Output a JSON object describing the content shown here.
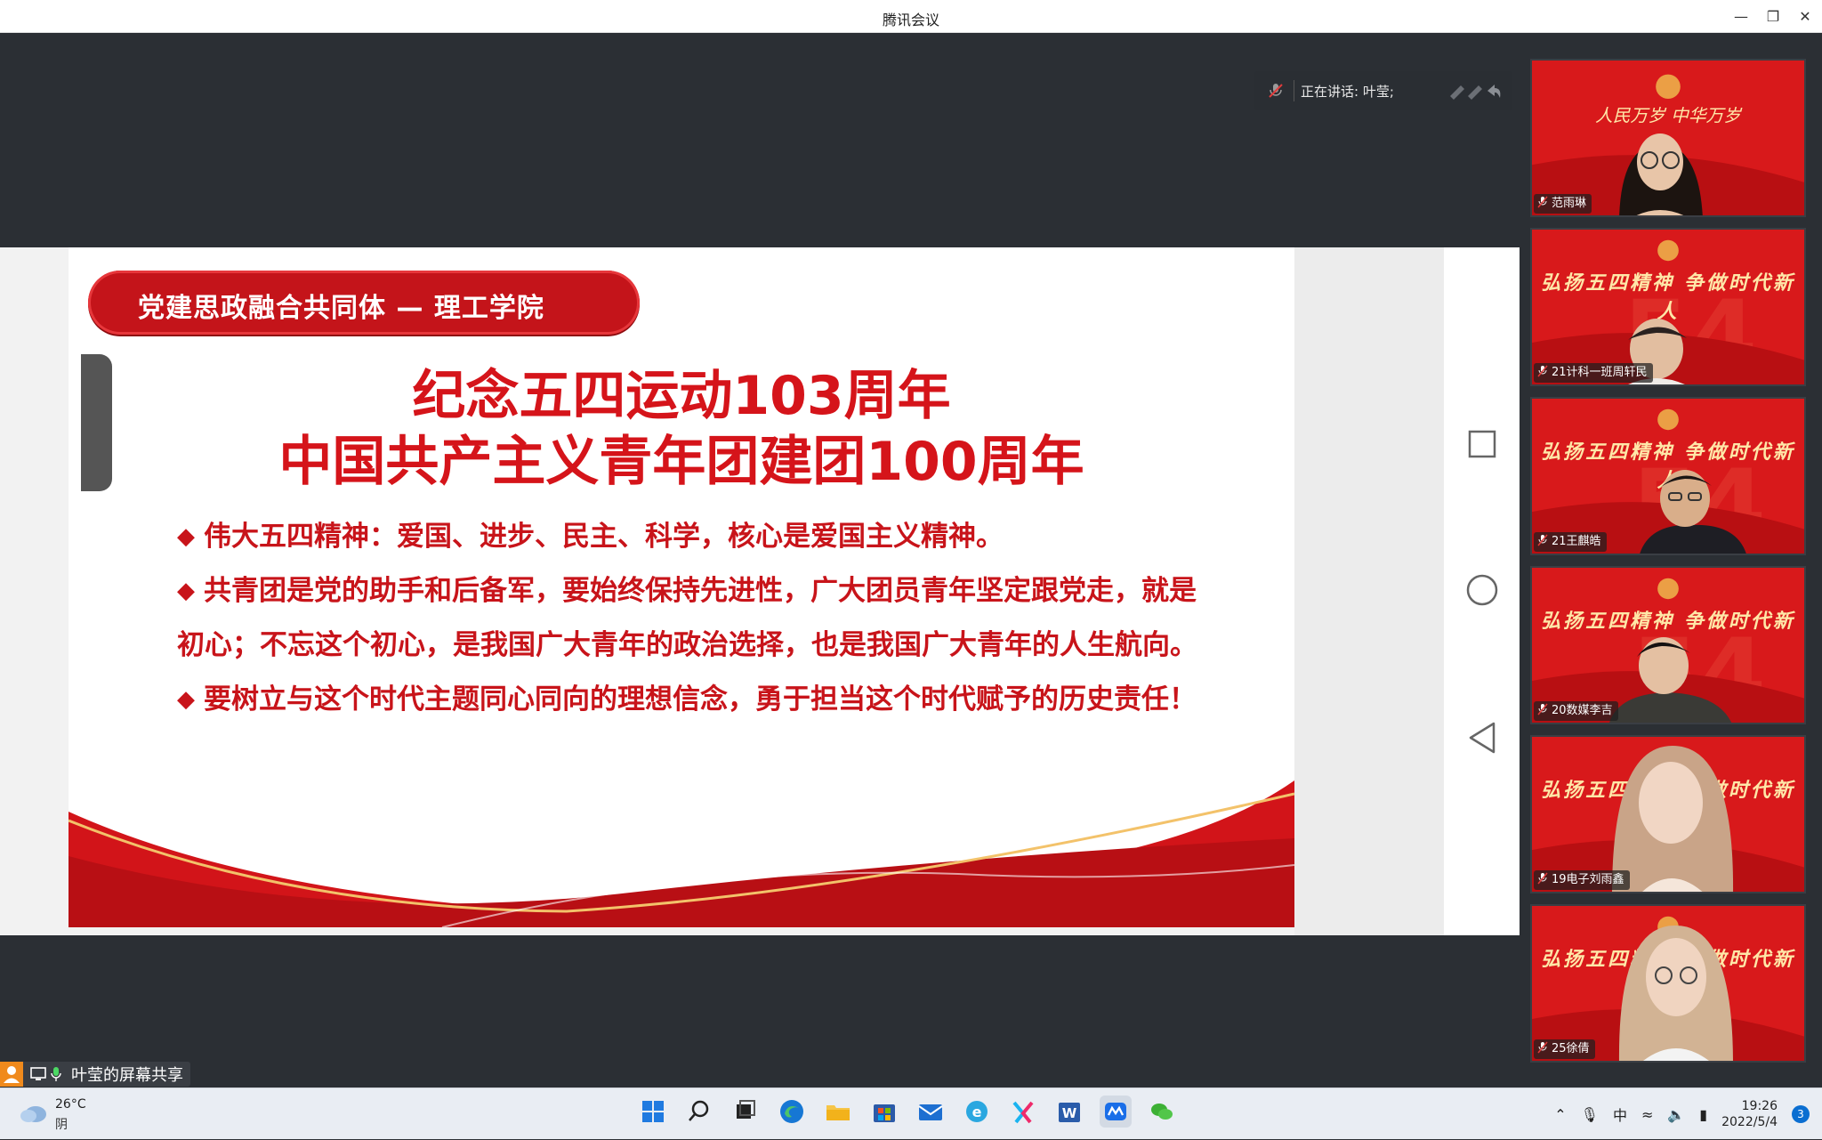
{
  "window": {
    "title": "腾讯会议",
    "minimize_icon": "minimize-icon",
    "restore_icon": "restore-icon",
    "close_icon": "close-icon"
  },
  "speaker_bar": {
    "label": "正在讲话: 叶莹;"
  },
  "slide": {
    "header": "党建思政融合共同体 — 理工学院",
    "title_line1": "纪念五四运动103周年",
    "title_line2": "中国共产主义青年团建团100周年",
    "bullets": [
      "伟大五四精神：爱国、进步、民主、科学，核心是爱国主义精神。",
      "共青团是党的助手和后备军，要始终保持先进性，广大团员青年坚定跟党走，就是初心；不忘这个初心，是我国广大青年的政治选择，也是我国广大青年的人生航向。",
      "要树立与这个时代主题同心同向的理想信念，勇于担当这个时代赋予的历史责任！"
    ],
    "colors": {
      "primary_red": "#d5141a",
      "header_red": "#c4141a"
    }
  },
  "participants": [
    {
      "name": "范雨琳",
      "banner": ""
    },
    {
      "name": "21计科一班周轩民",
      "banner": "弘扬五四精神  争做时代新人"
    },
    {
      "name": "21王麒皓",
      "banner": "弘扬五四精神  争做时代新人"
    },
    {
      "name": "20数媒李吉",
      "banner": "弘扬五四精神  争做时代新人"
    },
    {
      "name": "19电子刘雨鑫",
      "banner": "弘扬五四精神  争做时代新人"
    },
    {
      "name": "25徐倩",
      "banner": "弘扬五四精神  争做时代新人"
    }
  ],
  "share_tag": {
    "label": "叶莹的屏幕共享"
  },
  "taskbar": {
    "weather_temp": "26°C",
    "weather_cond": "阴",
    "ime": "中",
    "time": "19:26",
    "date": "2022/5/4",
    "notification_count": "3",
    "apps": [
      "start-icon",
      "search-icon",
      "task-view-icon",
      "edge-icon",
      "file-explorer-icon",
      "store-icon",
      "mail-icon",
      "ie-icon",
      "youku-icon",
      "word-icon",
      "tencent-meeting-icon",
      "wechat-icon"
    ]
  }
}
